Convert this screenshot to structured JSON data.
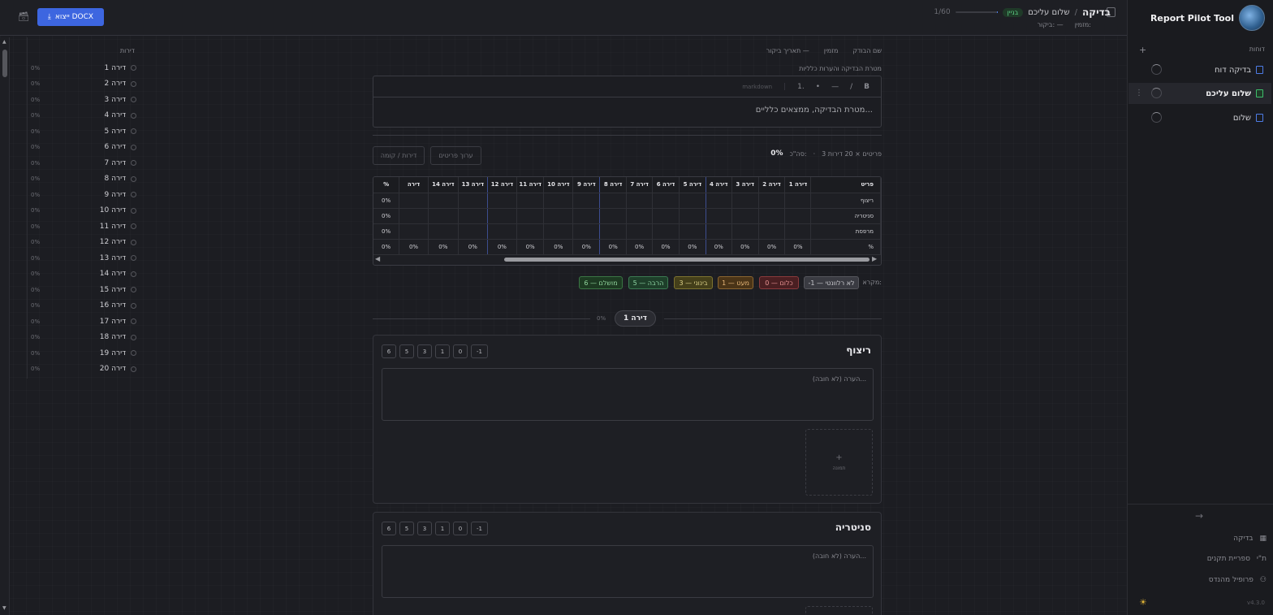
{
  "app": {
    "name": "Report Pilot Tool",
    "version": "v4.3.0"
  },
  "header": {
    "title": "בדיקה",
    "breadcrumb_sep": "/",
    "subtitle": "שלום עליכם",
    "badge": "בניין",
    "progress_text": "1/60",
    "progress_fraction": 0.0167,
    "meta_customer": "מזמין:",
    "meta_visit": "ביקור: —",
    "export_label": "ייצוא DOCX"
  },
  "sidebar": {
    "reports_label": "דוחות",
    "add_label": "+",
    "reports": [
      {
        "label": "בדיקה דוח",
        "active": false
      },
      {
        "label": "שלום עליכם",
        "active": true
      },
      {
        "label": "שלום",
        "active": false
      }
    ],
    "collapse_label": "→",
    "nav": [
      {
        "label": "בדיקה",
        "icon": "building-icon"
      },
      {
        "label": "ספריית תקנים",
        "icon": "standards-icon",
        "prefix": "ת\"י"
      },
      {
        "label": "פרופיל מהנדס",
        "icon": "user-icon"
      }
    ],
    "theme_icon": "☀"
  },
  "apartments_panel": {
    "title": "דירות",
    "items": [
      {
        "name": "דירה 1",
        "pct": "0%"
      },
      {
        "name": "דירה 2",
        "pct": "0%"
      },
      {
        "name": "דירה 3",
        "pct": "0%"
      },
      {
        "name": "דירה 4",
        "pct": "0%"
      },
      {
        "name": "דירה 5",
        "pct": "0%"
      },
      {
        "name": "דירה 6",
        "pct": "0%"
      },
      {
        "name": "דירה 7",
        "pct": "0%"
      },
      {
        "name": "דירה 8",
        "pct": "0%"
      },
      {
        "name": "דירה 9",
        "pct": "0%"
      },
      {
        "name": "דירה 10",
        "pct": "0%"
      },
      {
        "name": "דירה 11",
        "pct": "0%"
      },
      {
        "name": "דירה 12",
        "pct": "0%"
      },
      {
        "name": "דירה 13",
        "pct": "0%"
      },
      {
        "name": "דירה 14",
        "pct": "0%"
      },
      {
        "name": "דירה 15",
        "pct": "0%"
      },
      {
        "name": "דירה 16",
        "pct": "0%"
      },
      {
        "name": "דירה 17",
        "pct": "0%"
      },
      {
        "name": "דירה 18",
        "pct": "0%"
      },
      {
        "name": "דירה 19",
        "pct": "0%"
      },
      {
        "name": "דירה 20",
        "pct": "0%"
      }
    ]
  },
  "main": {
    "info": {
      "inspector": "שם הבודק",
      "customer": "מזמין",
      "visit_date": "תאריך ביקור —"
    },
    "purpose_label": "מטרת הבדיקה והערות כלליות",
    "toolbar": {
      "bold": "B",
      "italic": "/",
      "dash": "—",
      "bullet": "•",
      "numbered": "1.",
      "markdown": "markdown"
    },
    "editor_placeholder": "מטרת הבדיקה, ממצאים כלליים...",
    "grid_summary": {
      "dims": "3 פריטים × 20 דירות",
      "dot": "·",
      "total_label": "סה\"כ:",
      "total_value": "0%"
    },
    "edit_items_btn": "ערוך פריטים",
    "apt_floor_btn": "דירות / קומה",
    "matrix": {
      "item_header": "פריט",
      "columns": [
        "דירה 1",
        "דירה 2",
        "דירה 3",
        "דירה 4",
        "דירה 5",
        "דירה 6",
        "דירה 7",
        "דירה 8",
        "דירה 9",
        "דירה 10",
        "דירה 11",
        "דירה 12",
        "דירה 13",
        "דירה 14",
        "דירה"
      ],
      "pct_header": "%",
      "rows": [
        {
          "item": "ריצוף",
          "pct": "0%"
        },
        {
          "item": "סניטריה",
          "pct": "0%"
        },
        {
          "item": "מרפסת",
          "pct": "0%"
        }
      ],
      "total_row": {
        "label": "%",
        "cells": [
          "0%",
          "0%",
          "0%",
          "0%",
          "0%",
          "0%",
          "0%",
          "0%",
          "0%",
          "0%",
          "0%",
          "0%",
          "0%",
          "0%",
          "0%"
        ],
        "pct": "0%"
      }
    },
    "legend": {
      "label": "מקרא:",
      "chips": [
        "-1 — לא רלוונטי",
        "0 — כלום",
        "1 — מעט",
        "3 — בינוני",
        "5 — הרבה",
        "6 — מושלם"
      ]
    },
    "current_apartment": {
      "name": "דירה 1",
      "pct": "0%"
    },
    "cards": [
      {
        "title": "ריצוף",
        "scores": [
          "-1",
          "0",
          "1",
          "3",
          "5",
          "6"
        ],
        "note_placeholder": "הערה (לא חובה)...",
        "photo_label": "תמונה",
        "plus": "+"
      },
      {
        "title": "סניטריה",
        "scores": [
          "-1",
          "0",
          "1",
          "3",
          "5",
          "6"
        ],
        "note_placeholder": "הערה (לא חובה)..."
      }
    ]
  }
}
